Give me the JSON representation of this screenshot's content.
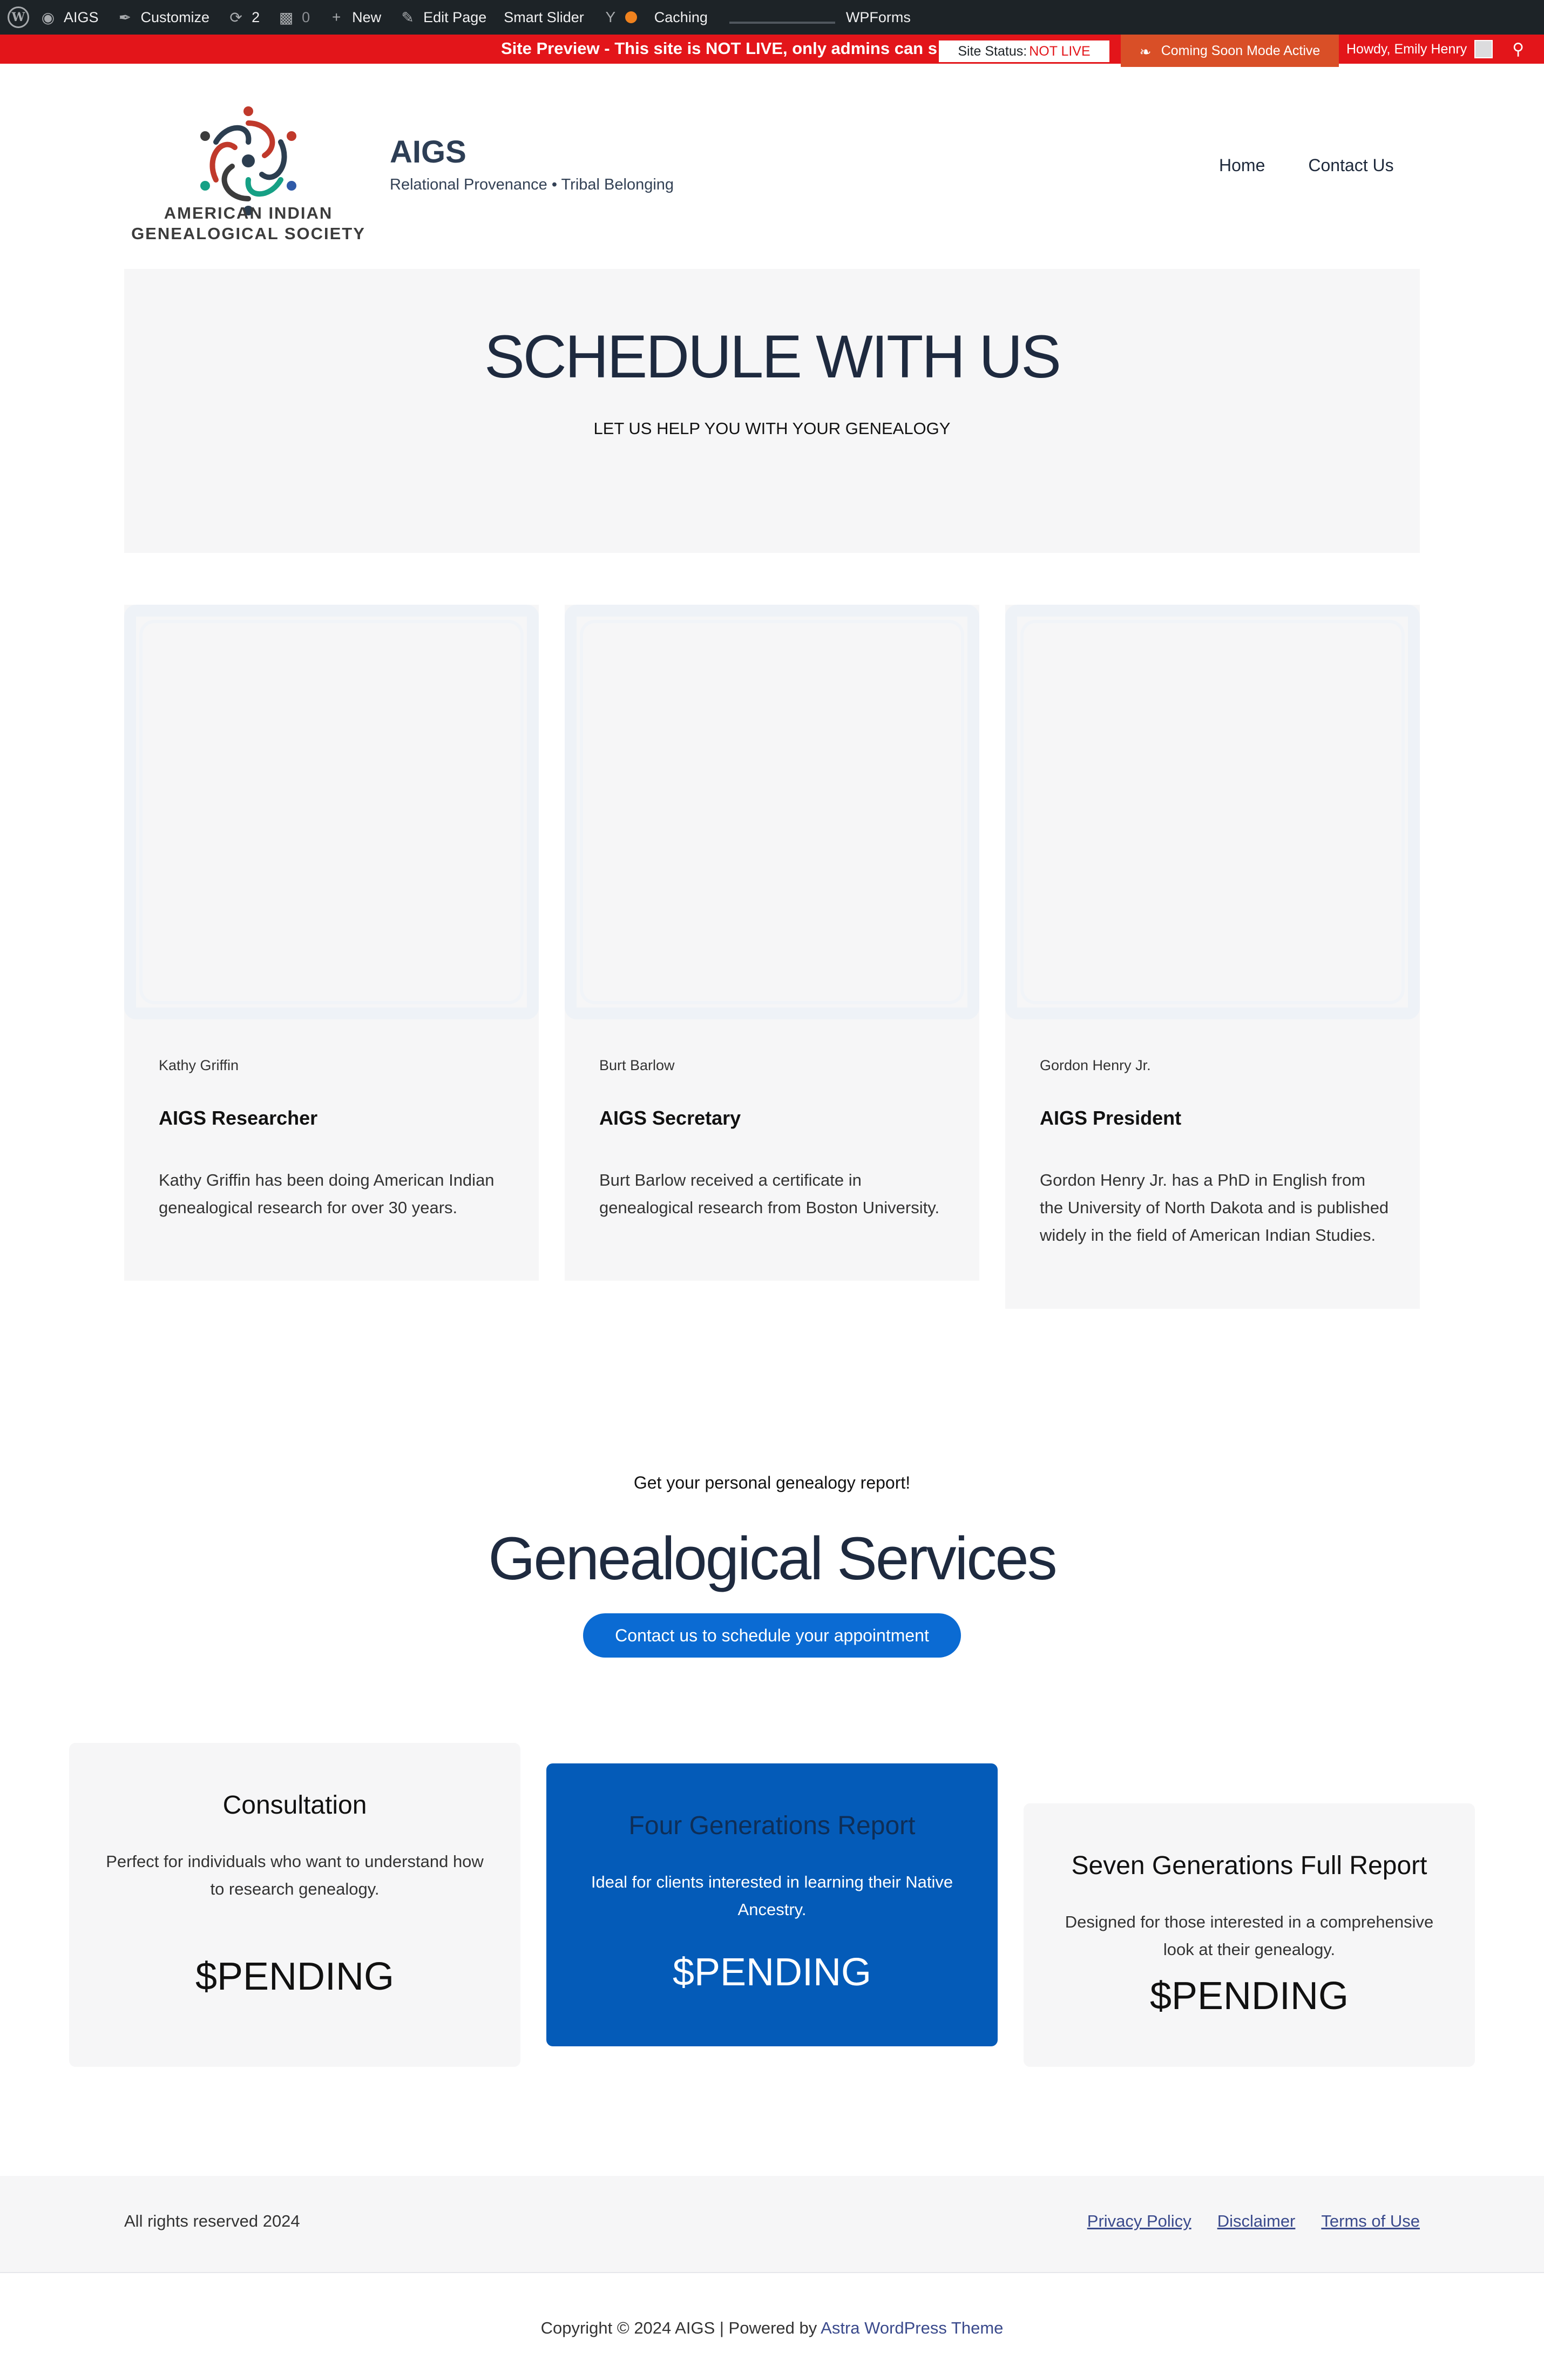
{
  "admin_bar": {
    "site_name": "AIGS",
    "customize": "Customize",
    "updates_count": "2",
    "comments_count": "0",
    "new": "New",
    "edit_page": "Edit Page",
    "smart_slider": "Smart Slider",
    "caching": "Caching",
    "wpforms": "WPForms",
    "howdy": "Howdy, Emily Henry"
  },
  "preview_bar": {
    "message": "Site Preview - This site is NOT LIVE, only admins can s",
    "site_status_label": "Site Status:",
    "site_status_value": "NOT LIVE",
    "coming_soon": "Coming Soon Mode Active"
  },
  "header": {
    "logo_text_line1": "AMERICAN INDIAN",
    "logo_text_line2": "GENEALOGICAL SOCIETY",
    "site_title": "AIGS",
    "tagline": "Relational Provenance • Tribal Belonging",
    "nav": [
      "Home",
      "Contact Us"
    ]
  },
  "hero": {
    "title": "SCHEDULE WITH US",
    "subtitle": "LET US HELP YOU WITH YOUR GENEALOGY"
  },
  "team": [
    {
      "name": "Kathy Griffin",
      "role": "AIGS Researcher",
      "bio": "Kathy Griffin has been doing American Indian genealogical research for over 30 years."
    },
    {
      "name": "Burt Barlow",
      "role": "AIGS Secretary",
      "bio": "Burt Barlow received a certificate in genealogical research from Boston University."
    },
    {
      "name": "Gordon Henry Jr.",
      "role": "AIGS President",
      "bio": "Gordon Henry Jr. has a PhD in English from the University of North Dakota and is published widely in the field of American Indian Studies."
    }
  ],
  "services": {
    "kicker": "Get your personal genealogy report!",
    "title": "Genealogical Services",
    "button": "Contact us to schedule your appointment",
    "plans": [
      {
        "title": "Consultation",
        "description": "Perfect for individuals who want to understand how to research genealogy.",
        "price": "$PENDING"
      },
      {
        "title": "Four Generations Report",
        "description": "Ideal for clients interested in learning their Native Ancestry.",
        "price": "$PENDING"
      },
      {
        "title": "Seven Generations Full Report",
        "description": "Designed for those interested in a comprehensive look at their genealogy.",
        "price": "$PENDING"
      }
    ]
  },
  "footer": {
    "rights": "All rights reserved 2024",
    "links": [
      "Privacy Policy",
      "Disclaimer",
      "Terms of Use"
    ],
    "copyright": "Copyright © 2024 AIGS | Powered by ",
    "theme_link": "Astra WordPress Theme"
  },
  "colors": {
    "admin_bar": "#1d2327",
    "preview_red": "#e3151a",
    "coming_soon_orange": "#d94f27",
    "button_blue": "#0b6bd3",
    "featured_plan_blue": "#045bb8",
    "card_gray": "#f6f6f7"
  },
  "icons": [
    "wordpress-icon",
    "brush-icon",
    "updates-icon",
    "comment-icon",
    "plus-icon",
    "pencil-icon",
    "yoast-icon",
    "status-dot-icon",
    "leaf-icon",
    "avatar",
    "search-icon"
  ]
}
